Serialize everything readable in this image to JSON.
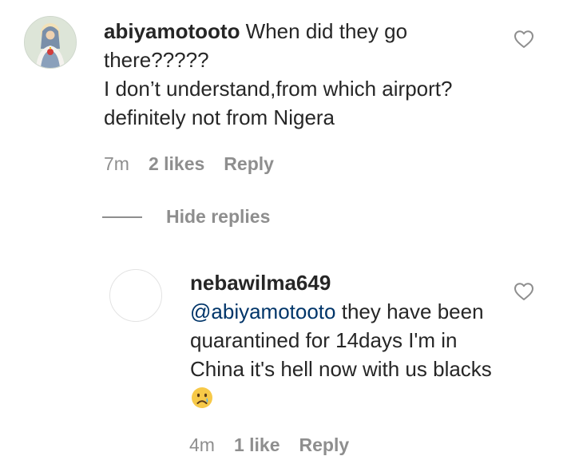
{
  "comment_main": {
    "username": "abiyamotooto",
    "text_line1": " When did they go there?????",
    "text_line2": "I don’t understand,from which airport? definitely not from Nigera",
    "time": "7m",
    "likes": "2 likes",
    "reply_label": "Reply",
    "like_icon": "heart-outline-icon",
    "avatar_icon": "religious-portrait-avatar"
  },
  "replies_toggle": {
    "label": "Hide replies"
  },
  "comment_reply": {
    "username": "nebawilma649",
    "mention": "@abiyamotooto",
    "text": " they have been quarantined for 14days I'm in China it's hell now with us blacks",
    "emoji_name": "crying-face-emoji",
    "time": "4m",
    "likes": "1 like",
    "reply_label": "Reply",
    "like_icon": "heart-outline-icon"
  },
  "colors": {
    "text": "#262626",
    "secondary": "#8e8e8e",
    "mention": "#003569"
  }
}
